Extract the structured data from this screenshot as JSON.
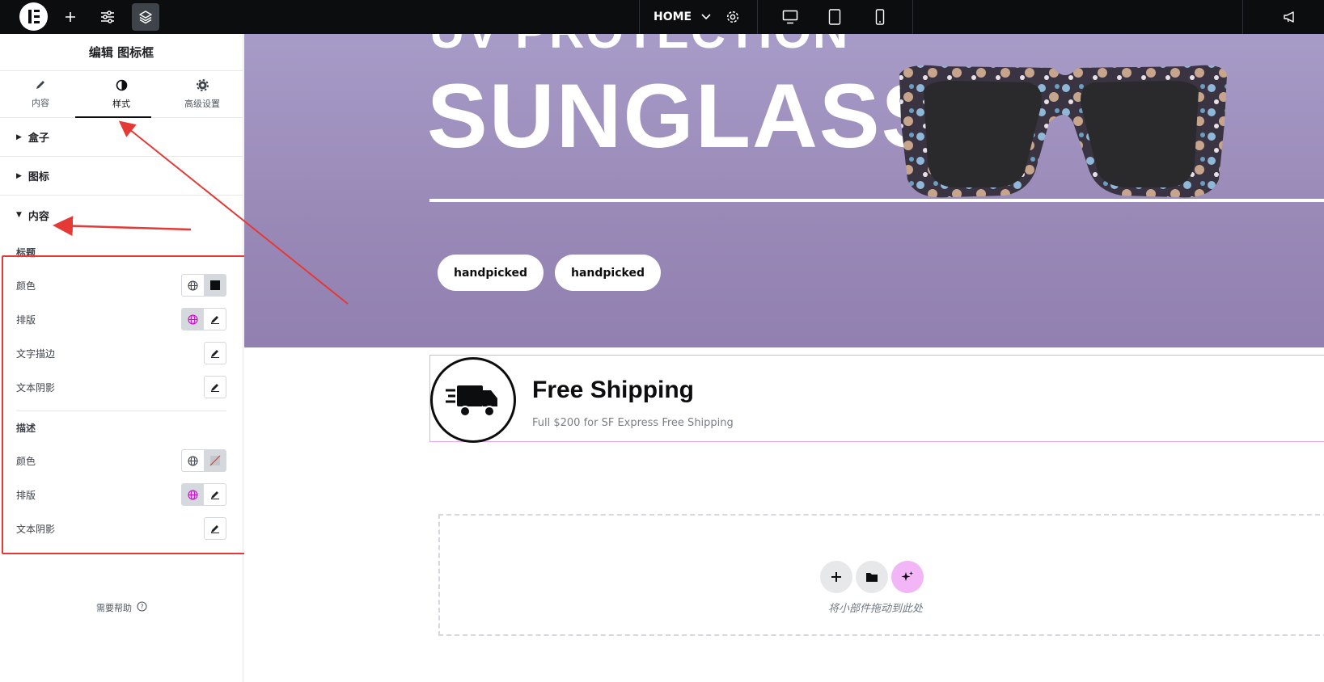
{
  "topbar": {
    "logo_icon": "elementor-logo-icon",
    "add_icon": "plus-icon",
    "settings_icon": "sliders-icon",
    "structure_icon": "layers-icon",
    "page_label": "HOME",
    "page_dropdown_icon": "chevron-down-icon",
    "page_settings_icon": "gear-icon",
    "devices": [
      "desktop-icon",
      "tablet-icon",
      "mobile-icon"
    ],
    "notifications_icon": "megaphone-icon"
  },
  "sidebar": {
    "title": "编辑 图标框",
    "tabs": [
      {
        "label": "内容",
        "icon": "pencil-icon"
      },
      {
        "label": "样式",
        "icon": "contrast-icon"
      },
      {
        "label": "高级设置",
        "icon": "gear-icon"
      }
    ],
    "active_tab": 1,
    "sections": [
      {
        "label": "盒子",
        "expanded": false
      },
      {
        "label": "图标",
        "expanded": false
      },
      {
        "label": "内容",
        "expanded": true
      }
    ],
    "title_group": {
      "heading": "标题",
      "color_label": "颜色",
      "typography_label": "排版",
      "stroke_label": "文字描边",
      "shadow_label": "文本阴影",
      "color_swatch": "#0c0d0e"
    },
    "desc_group": {
      "heading": "描述",
      "color_label": "颜色",
      "typography_label": "排版",
      "shadow_label": "文本阴影"
    },
    "help_label": "需要帮助",
    "accent_color": "#d004d4",
    "highlight_color": "#e53935"
  },
  "canvas": {
    "hero_top_text": "UV PROTECTION",
    "hero_title": "SUNGLASS",
    "pills": [
      "handpicked",
      "handpicked"
    ],
    "feature_title": "Free Shipping",
    "feature_desc": "Full $200 for SF Express Free Shipping",
    "feature_icon": "delivery-truck-icon",
    "dropzone_text": "将小部件拖动到此处",
    "dropzone_buttons": [
      "plus-icon",
      "folder-icon",
      "ai-sparkle-icon"
    ]
  }
}
